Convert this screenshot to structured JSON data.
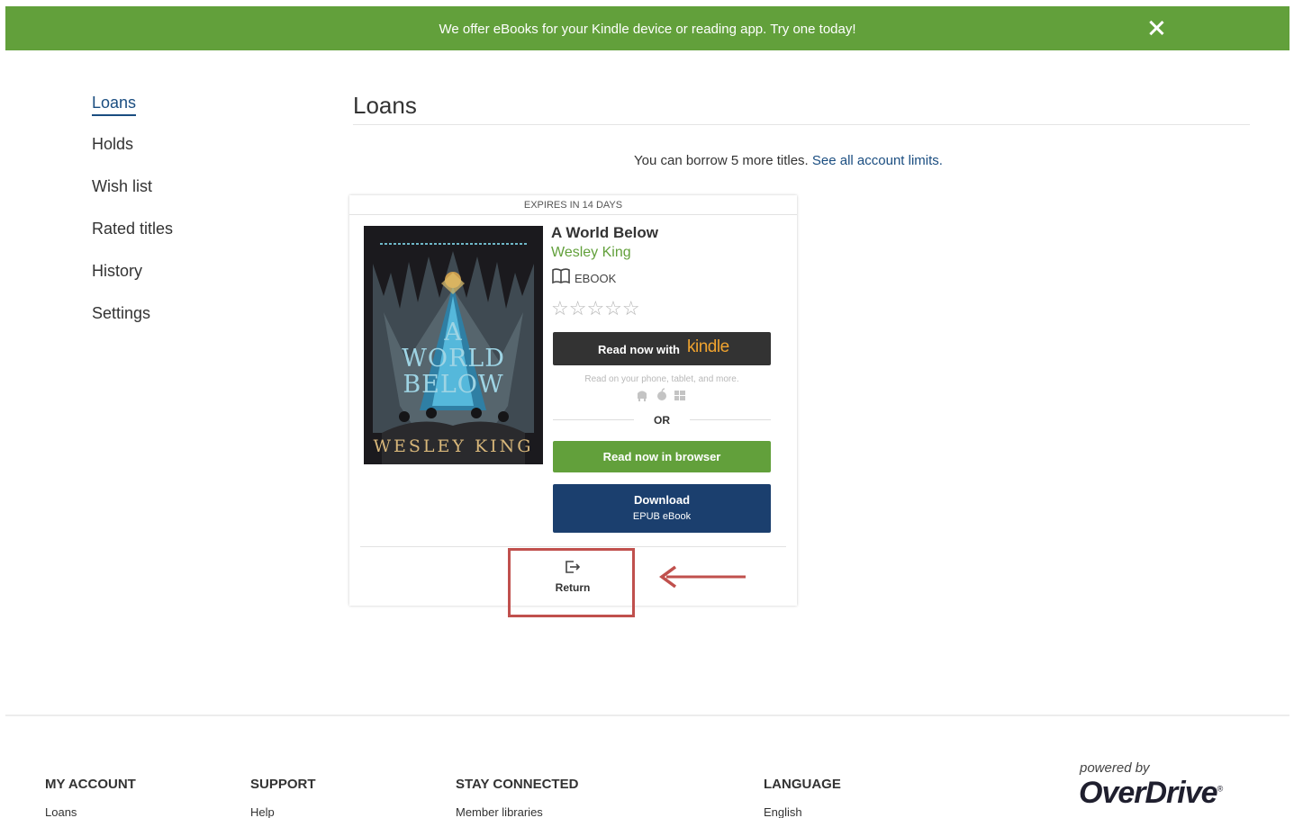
{
  "banner": {
    "text": "We offer eBooks for your Kindle device or reading app. Try one today!",
    "close_icon": "close-icon"
  },
  "sidebar": {
    "items": [
      {
        "label": "Loans",
        "active": true
      },
      {
        "label": "Holds"
      },
      {
        "label": "Wish list"
      },
      {
        "label": "Rated titles"
      },
      {
        "label": "History"
      },
      {
        "label": "Settings"
      }
    ]
  },
  "main": {
    "title": "Loans",
    "limits_text": "You can borrow 5 more titles.",
    "limits_link": "See all account limits."
  },
  "loan": {
    "expires": "EXPIRES IN 14 DAYS",
    "cover": {
      "title_line1": "A",
      "title_line2": "WORLD",
      "title_line3": "BELOW",
      "author": "WESLEY KING"
    },
    "title": "A World Below",
    "author": "Wesley King",
    "format": "EBOOK",
    "format_icon": "open-book-icon",
    "rating_stars": "☆☆☆☆☆",
    "kindle_button": {
      "label": "Read now with",
      "brand": "kindle"
    },
    "read_hint": "Read on your phone, tablet, and more.",
    "platform_icons": [
      "android-icon",
      "apple-icon",
      "windows-icon"
    ],
    "or_text": "OR",
    "browser_button": "Read now in browser",
    "download_button": {
      "line1": "Download",
      "line2": "EPUB eBook"
    },
    "return_label": "Return",
    "return_icon": "return-icon"
  },
  "annotation": {
    "highlight_color": "#c0504d"
  },
  "colors": {
    "brand_green": "#62a03b",
    "link_blue": "#1a4d80",
    "dark_button": "#333333",
    "download_blue": "#1b3f6e"
  },
  "footer": {
    "columns": [
      {
        "heading": "MY ACCOUNT",
        "link": "Loans"
      },
      {
        "heading": "SUPPORT",
        "link": "Help"
      },
      {
        "heading": "STAY CONNECTED",
        "link": "Member libraries"
      },
      {
        "heading": "LANGUAGE",
        "link": "English"
      }
    ],
    "powered_by": "powered by",
    "logo": "OverDrive"
  }
}
